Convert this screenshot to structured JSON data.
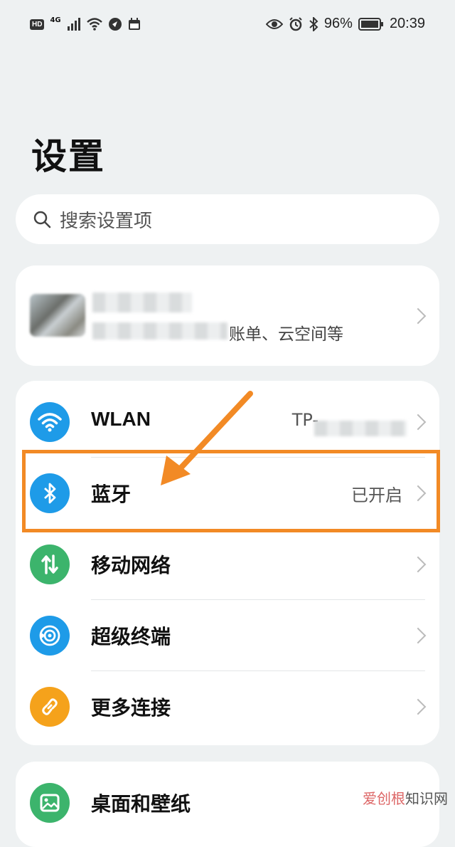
{
  "status_bar": {
    "hd": "HD",
    "network": "4G",
    "battery_percent": "96%",
    "time": "20:39",
    "left_icons": [
      "hd-badge",
      "signal-icon",
      "wifi-icon",
      "vpn-icon",
      "calendar-icon"
    ],
    "right_icons": [
      "eye-icon",
      "alarm-icon",
      "bluetooth-icon",
      "battery-icon"
    ]
  },
  "page": {
    "title": "设置"
  },
  "search": {
    "placeholder": "搜索设置项"
  },
  "account": {
    "subtitle": "账单、云空间等"
  },
  "connections": [
    {
      "label": "WLAN",
      "value": "TP-",
      "icon": "wifi-icon",
      "color": "#1e9be8"
    },
    {
      "label": "蓝牙",
      "value": "已开启",
      "icon": "bluetooth-icon",
      "color": "#1e9be8"
    },
    {
      "label": "移动网络",
      "value": "",
      "icon": "mobile-data-icon",
      "color": "#3cb46c"
    },
    {
      "label": "超级终端",
      "value": "",
      "icon": "super-device-icon",
      "color": "#1e9be8"
    },
    {
      "label": "更多连接",
      "value": "",
      "icon": "link-icon",
      "color": "#f5a21b"
    }
  ],
  "display": {
    "label": "桌面和壁纸",
    "icon": "wallpaper-icon",
    "color": "#3cb46c"
  },
  "annotation": {
    "highlight_color": "#f28a25"
  },
  "watermark": {
    "text_a": "爱创根",
    "text_b": "知识网"
  }
}
